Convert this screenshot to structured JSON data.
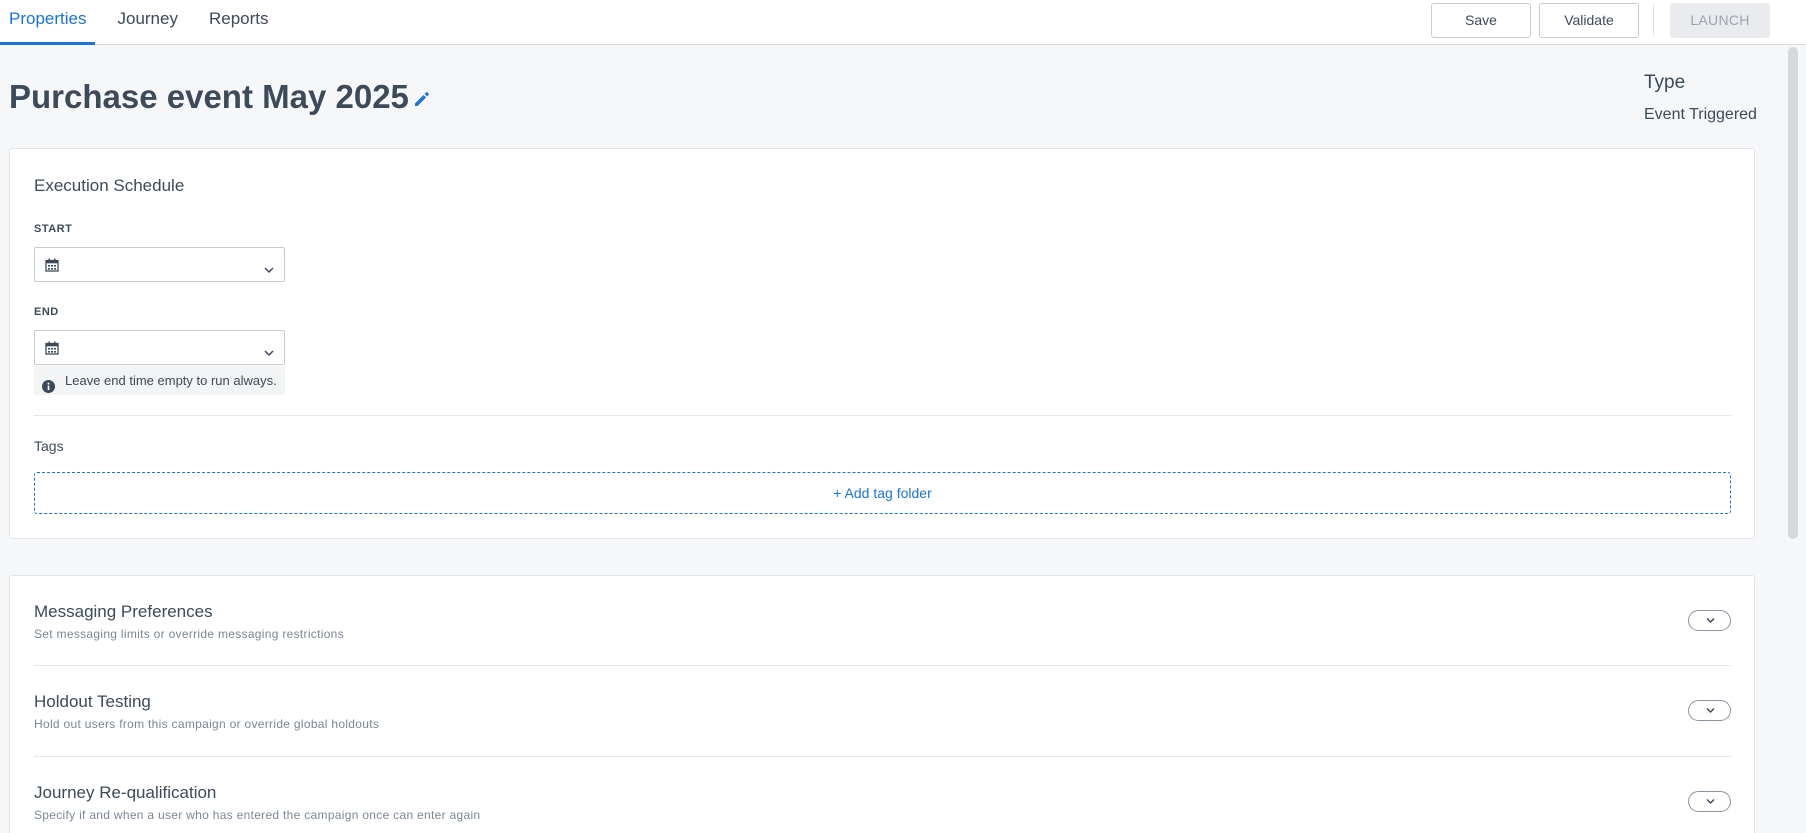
{
  "tabs": [
    {
      "label": "Properties",
      "active": true
    },
    {
      "label": "Journey",
      "active": false
    },
    {
      "label": "Reports",
      "active": false
    }
  ],
  "toolbar": {
    "save_label": "Save",
    "validate_label": "Validate",
    "launch_label": "LAUNCH"
  },
  "header": {
    "title": "Purchase event May 2025",
    "type_label": "Type",
    "type_value": "Event Triggered"
  },
  "schedule": {
    "title": "Execution Schedule",
    "start_label": "START",
    "start_value": "",
    "end_label": "END",
    "end_value": "",
    "end_hint": "Leave end time empty to run always."
  },
  "tags": {
    "label": "Tags",
    "add_label": "+ Add tag folder"
  },
  "sections": [
    {
      "title": "Messaging Preferences",
      "subtitle": "Set messaging limits or override messaging restrictions"
    },
    {
      "title": "Holdout Testing",
      "subtitle": "Hold out users from this campaign or override global holdouts"
    },
    {
      "title": "Journey Re-qualification",
      "subtitle": "Specify if and when a user who has entered the campaign once can enter again"
    }
  ],
  "colors": {
    "accent": "#1a73d9",
    "text": "#3c4a5a",
    "muted": "#7b8794",
    "background": "#f6f7f9"
  },
  "icons": {
    "edit": "pencil-icon",
    "calendar": "calendar-icon",
    "chevron": "chevron-down-icon",
    "info": "info-icon"
  }
}
